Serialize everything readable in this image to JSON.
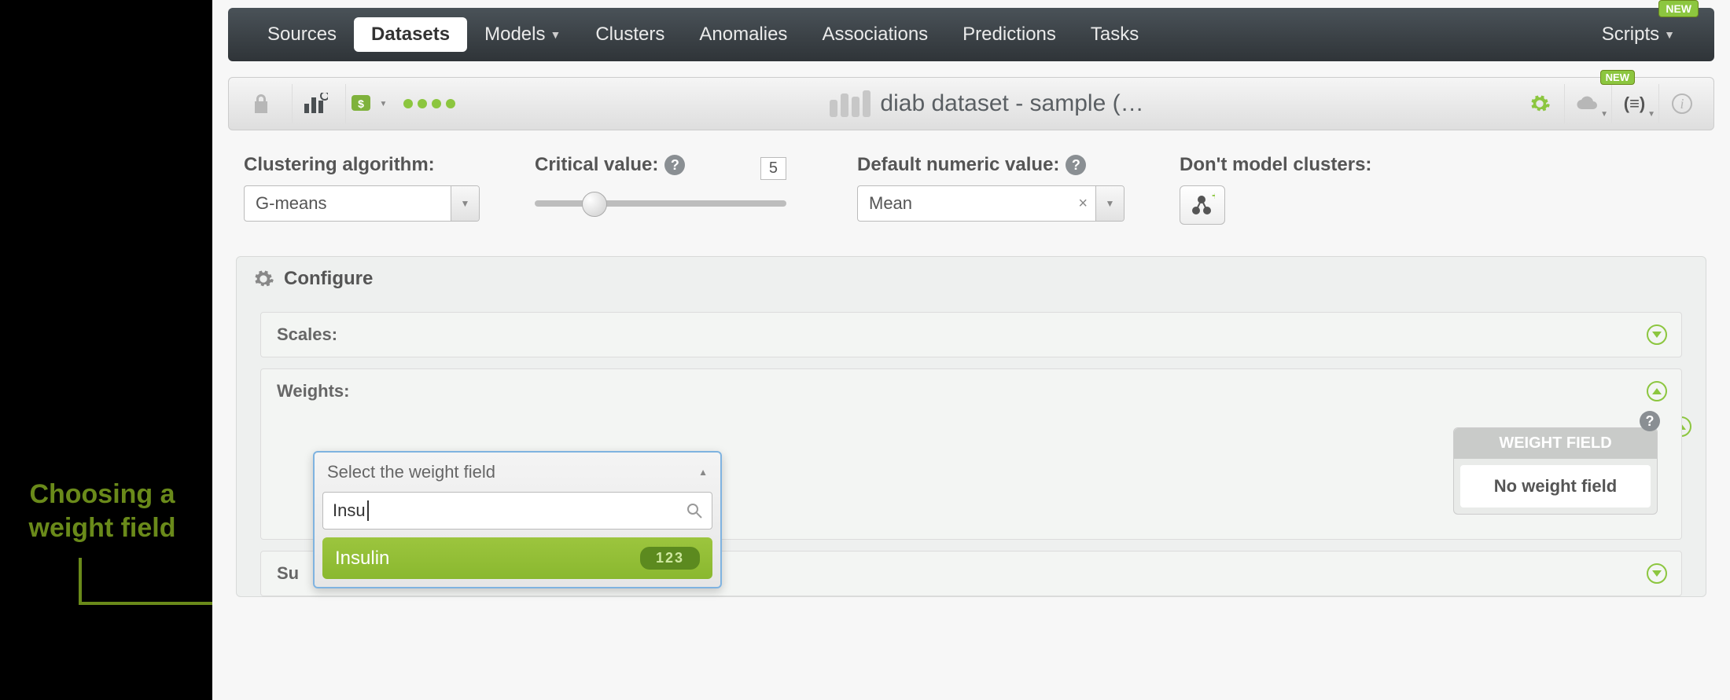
{
  "nav": {
    "items": [
      "Sources",
      "Datasets",
      "Models",
      "Clusters",
      "Anomalies",
      "Associations",
      "Predictions",
      "Tasks"
    ],
    "active_index": 1,
    "right_item": "Scripts",
    "new_badge": "NEW"
  },
  "toolbar": {
    "title": "diab dataset - sample (…",
    "new_badge": "NEW"
  },
  "config": {
    "algorithm": {
      "label": "Clustering algorithm:",
      "value": "G-means"
    },
    "critical": {
      "label": "Critical value:",
      "value": "5"
    },
    "numeric": {
      "label": "Default numeric value:",
      "value": "Mean"
    },
    "dont_model": {
      "label": "Don't model clusters:"
    }
  },
  "panels": {
    "configure": "Configure",
    "scales": "Scales:",
    "weights": "Weights:",
    "summary_prefix": "Su"
  },
  "weight_field_box": {
    "title": "WEIGHT FIELD",
    "text": "No weight field"
  },
  "dropdown": {
    "placeholder": "Select the weight field",
    "search_value": "Insu",
    "option_label": "Insulin",
    "option_badge": "123"
  },
  "annotation": {
    "line1": "Choosing a",
    "line2": "weight field"
  }
}
